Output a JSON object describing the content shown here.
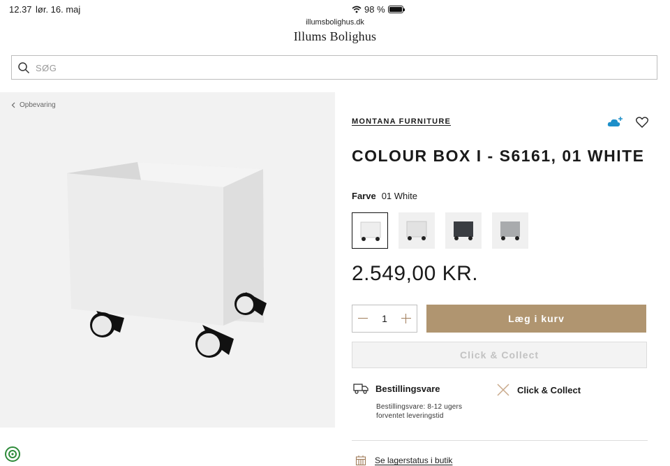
{
  "status_bar": {
    "time": "12.37",
    "date": "lør. 16. maj",
    "battery": "98 %"
  },
  "browser": {
    "url": "illumsbolighus.dk"
  },
  "site": {
    "brand": "Illums Bolighus"
  },
  "search": {
    "placeholder": "SØG"
  },
  "breadcrumb": {
    "label": "Opbevaring"
  },
  "product": {
    "brand": "MONTANA FURNITURE",
    "title": "COLOUR BOX I - S6161, 01 WHITE",
    "color_label": "Farve",
    "color_value": "01 White",
    "swatches": [
      {
        "name": "01 White",
        "color": "#eeeeee",
        "selected": true
      },
      {
        "name": "Light grey",
        "color": "#e2e2e2",
        "selected": false
      },
      {
        "name": "Anthracite",
        "color": "#3a3d42",
        "selected": false
      },
      {
        "name": "Grey",
        "color": "#a9abad",
        "selected": false
      }
    ],
    "price": "2.549,00 KR.",
    "quantity": "1",
    "add_to_cart": "Læg i kurv",
    "click_collect_button": "Click & Collect",
    "delivery_title": "Bestillingsvare",
    "delivery_text_line1": "Bestillingsvare: 8-12 ugers",
    "delivery_text_line2": "forventet leveringstid",
    "click_collect_info": "Click & Collect",
    "stock_link": "Se lagerstatus i butik"
  },
  "colors": {
    "accent": "#b09570",
    "accent_text": "#a07c5a",
    "cloud": "#1d8fc9"
  }
}
